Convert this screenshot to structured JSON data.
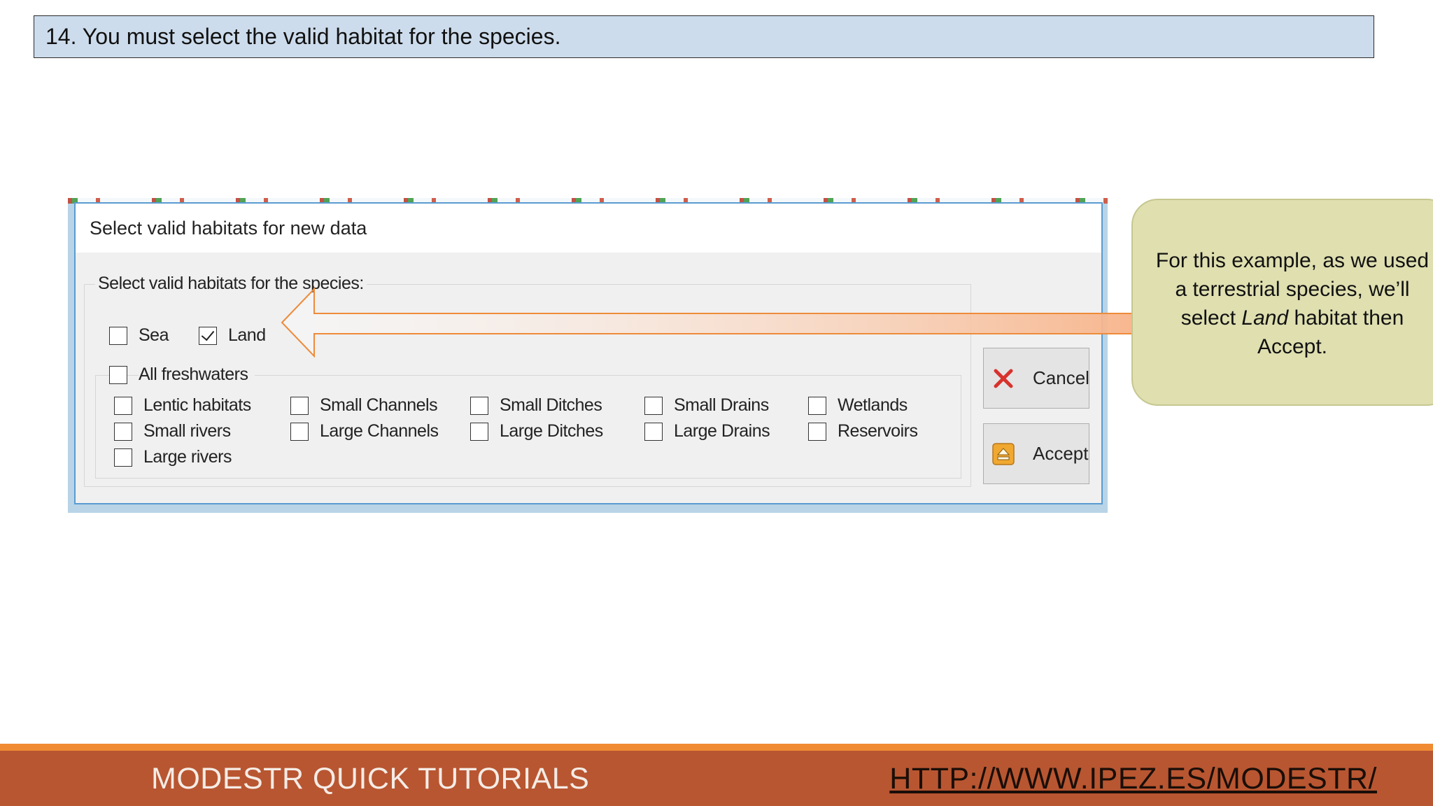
{
  "slide": {
    "step_title": "14. You must select the valid habitat for the species."
  },
  "dialog": {
    "title": "Select  valid habitats for new data",
    "group_label": "Select valid habitats for the species:",
    "top_options": [
      {
        "label": "Sea",
        "checked": false
      },
      {
        "label": "Land",
        "checked": true
      }
    ],
    "freshwater": {
      "label": "All freshwaters",
      "checked": false
    },
    "habitats": [
      {
        "label": "Lentic habitats",
        "checked": false
      },
      {
        "label": "Small rivers",
        "checked": false
      },
      {
        "label": "Large rivers",
        "checked": false
      },
      {
        "label": "Small Channels",
        "checked": false
      },
      {
        "label": "Large Channels",
        "checked": false
      },
      {
        "label": "Small Ditches",
        "checked": false
      },
      {
        "label": "Large Ditches",
        "checked": false
      },
      {
        "label": "Small Drains",
        "checked": false
      },
      {
        "label": "Large Drains",
        "checked": false
      },
      {
        "label": "Wetlands",
        "checked": false
      },
      {
        "label": "Reservoirs",
        "checked": false
      }
    ],
    "buttons": {
      "cancel": {
        "label": "Cancel",
        "icon": "red-x-icon",
        "color": "#d8322d"
      },
      "accept": {
        "label": "Accept",
        "icon": "eject-icon",
        "color": "#f0a830"
      }
    }
  },
  "callout": {
    "text_before": "For this example, as we used a terrestrial species, we’ll select ",
    "emphasis": "Land",
    "text_after": " habitat then Accept."
  },
  "footer": {
    "title": "MODESTR QUICK TUTORIALS",
    "link": "HTTP://WWW.IPEZ.ES/MODESTR/"
  },
  "colors": {
    "banner": "#cddcec",
    "footer": "#b85631",
    "footer_line": "#f08b34",
    "arrow_stroke": "#ee8b3a",
    "callout": "#dfdfb0"
  }
}
